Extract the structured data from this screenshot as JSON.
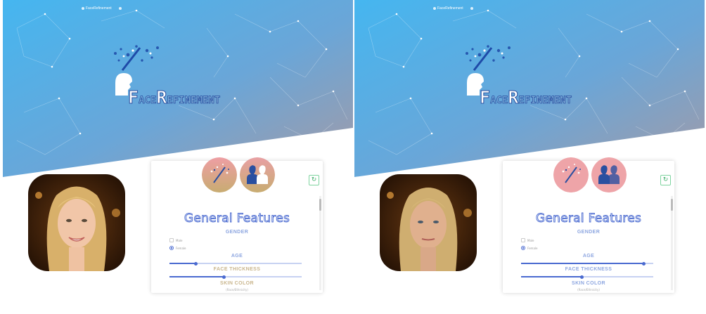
{
  "colors": {
    "sky_start": "#4ab2ec",
    "sky_end": "#9a9aa8",
    "accent": "#4a6ad0",
    "label_tan": "#c9b58c",
    "refresh_green": "#3fb06a"
  },
  "panels": [
    {
      "nav": {
        "brand": "FaceRefinement",
        "icon": "info-icon"
      },
      "brand": {
        "cap1": "F",
        "rest1": "ACE",
        "cap2": "R",
        "rest2": "EFINEMENT"
      },
      "card": {
        "title": "General Features",
        "gender_label": "GENDER",
        "gender_options": [
          "Male",
          "Female"
        ],
        "gender_selected": "Female",
        "age_label": "AGE",
        "age_value": 0.2,
        "thickness_label": "FACE THICKNESS",
        "thickness_value": 0.41,
        "skin_label": "SKIN COLOR",
        "skin_hint": "(Race/Ethnicity)"
      },
      "photo": {
        "subject": "young-smiling-blonde-woman"
      }
    },
    {
      "nav": {
        "brand": "FaceRefinement",
        "icon": "info-icon"
      },
      "brand": {
        "cap1": "F",
        "rest1": "ACE",
        "cap2": "R",
        "rest2": "EFINEMENT"
      },
      "card": {
        "title": "General Features",
        "gender_label": "GENDER",
        "gender_options": [
          "Male",
          "Female"
        ],
        "gender_selected": "Female",
        "age_label": "AGE",
        "age_value": 0.93,
        "thickness_label": "FACE THICKNESS",
        "thickness_value": 0.46,
        "skin_label": "SKIN COLOR",
        "skin_hint": "(Race/Ethnicity)"
      },
      "photo": {
        "subject": "older-blonde-woman"
      }
    }
  ]
}
